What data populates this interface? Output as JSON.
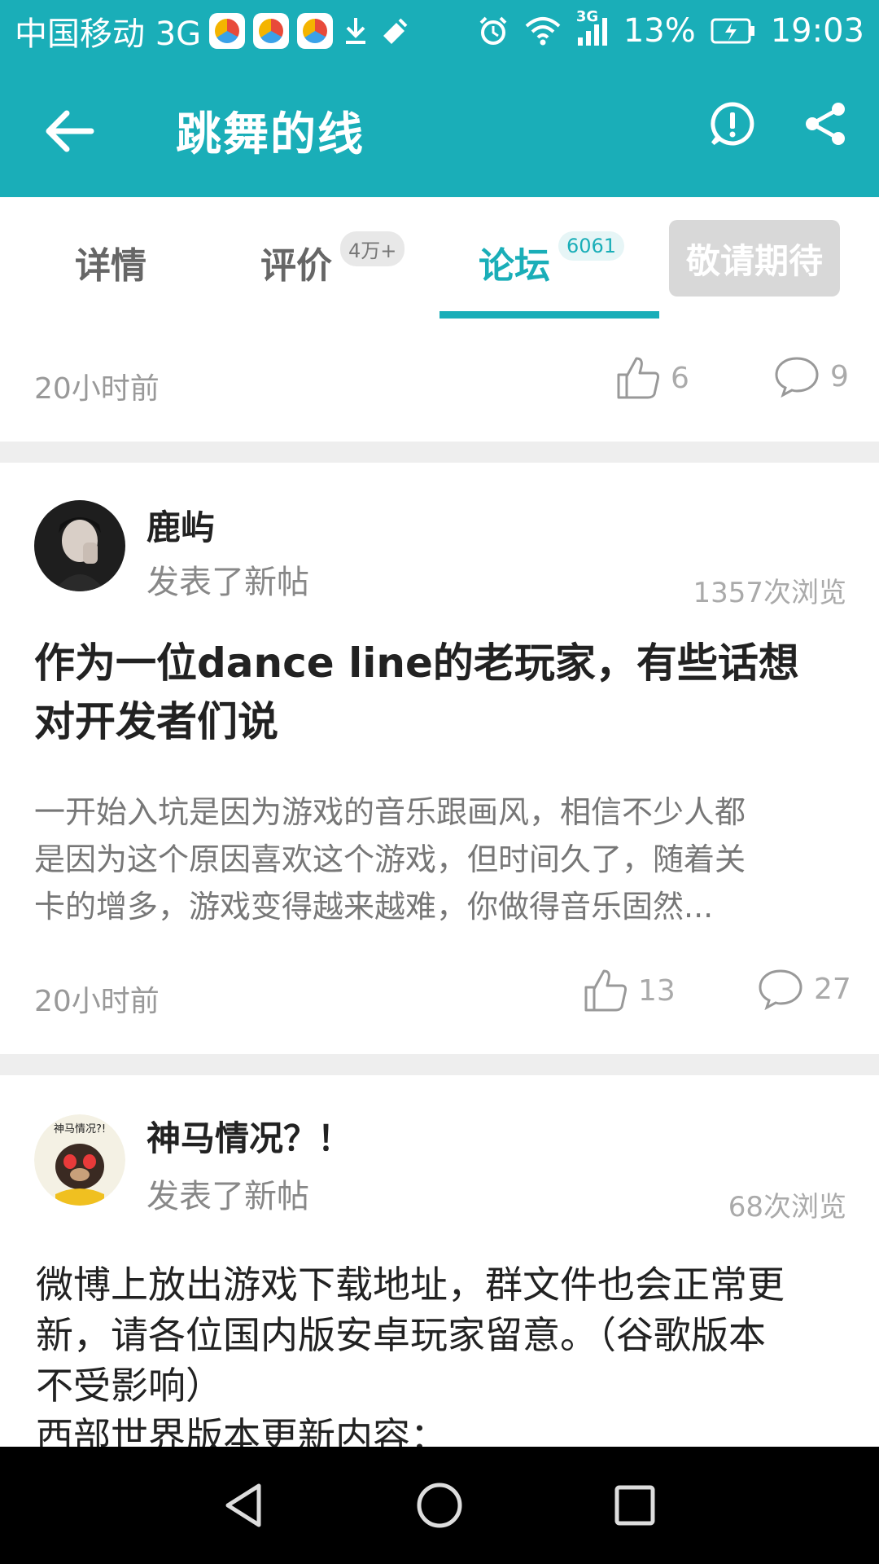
{
  "status_bar": {
    "carrier": "中国移动 3G",
    "network_label": "3G",
    "battery": "13%",
    "time": "19:03"
  },
  "app_bar": {
    "title": "跳舞的线"
  },
  "tabs": [
    {
      "label": "详情",
      "badge": ""
    },
    {
      "label": "评价",
      "badge": "4万+"
    },
    {
      "label": "论坛",
      "badge": "6061"
    }
  ],
  "tab_cta": "敬请期待",
  "top_meta": {
    "time": "20小时前",
    "likes": "6",
    "comments": "9"
  },
  "posts": [
    {
      "author": "鹿屿",
      "action": "发表了新帖",
      "views": "1357次浏览",
      "title_line1": "作为一位dance line的老玩家，有些话想",
      "title_line2": "对开发者们说",
      "excerpt_line1": "一开始入坑是因为游戏的音乐跟画风，相信不少人都",
      "excerpt_line2": "是因为这个原因喜欢这个游戏，但时间久了，随着关",
      "excerpt_line3": "卡的增多，游戏变得越来越难，你做得音乐固然...",
      "time": "20小时前",
      "likes": "13",
      "comments": "27"
    },
    {
      "author": "神马情况？！",
      "action": "发表了新帖",
      "views": "68次浏览",
      "avatar_caption": "神马情况?!",
      "preview_line1": "微博上放出游戏下载地址，群文件也会正常更",
      "preview_line2": "新，请各位国内版安卓玩家留意。（谷歌版本",
      "preview_line3": "不受影响）",
      "preview_line4": "西部世界版本更新内容："
    }
  ],
  "colors": {
    "accent": "#1aaeb8",
    "divider": "#eeeeee",
    "muted": "#999999"
  },
  "icons": [
    "back-arrow-icon",
    "report-icon",
    "share-icon",
    "thumbs-up-icon",
    "comment-icon",
    "nav-back-icon",
    "nav-home-icon",
    "nav-recents-icon"
  ]
}
